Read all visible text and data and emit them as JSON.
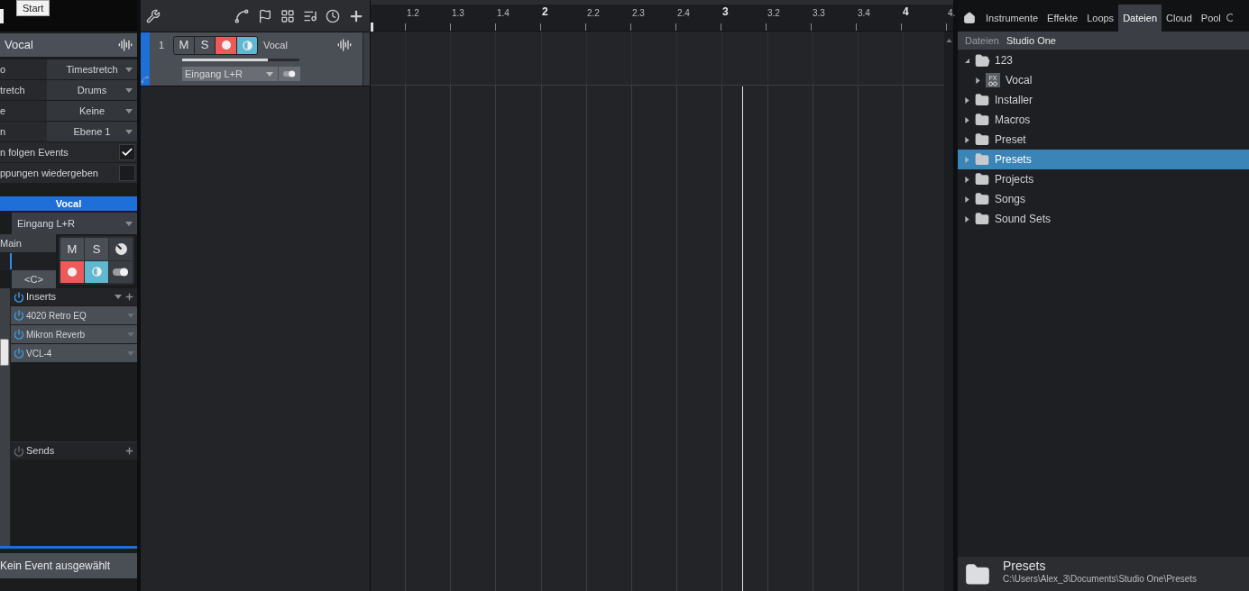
{
  "tooltip": {
    "text": "Start"
  },
  "inspector": {
    "title": "Vocal",
    "properties": [
      {
        "label": "o",
        "value": "Timestretch"
      },
      {
        "label": "tretch",
        "value": "Drums"
      },
      {
        "label": "e",
        "value": "Keine"
      },
      {
        "label": "n",
        "value": "Ebene 1"
      }
    ],
    "options": [
      {
        "label": "n folgen Events",
        "checked": true
      },
      {
        "label": "ppungen wiedergeben",
        "checked": false
      }
    ]
  },
  "channel": {
    "name": "Vocal",
    "input": "Eingang L+R",
    "output": "Main",
    "pan": "<C>",
    "mute": {
      "label": "M",
      "on": false
    },
    "solo": {
      "label": "S",
      "on": false
    },
    "record_armed": true,
    "monitor": true,
    "inserts": {
      "title": "Inserts",
      "on": true,
      "items": [
        {
          "name": "4020 Retro EQ",
          "on": true
        },
        {
          "name": "Mikron Reverb",
          "on": true
        },
        {
          "name": "VCL-4",
          "on": true
        }
      ]
    },
    "sends": {
      "title": "Sends",
      "on": false
    }
  },
  "status": "Kein Event ausgewählt",
  "track": {
    "number": "1",
    "name": "Vocal",
    "mute": {
      "label": "M",
      "on": false
    },
    "solo": {
      "label": "S",
      "on": false
    },
    "record_armed": true,
    "monitor": true,
    "level": 0.73,
    "input": "Eingang L+R",
    "selected": true
  },
  "ruler": [
    {
      "label": "1.2",
      "kind": "beat"
    },
    {
      "label": "1.3",
      "kind": "beat"
    },
    {
      "label": "1.4",
      "kind": "beat"
    },
    {
      "label": "2",
      "kind": "bar"
    },
    {
      "label": "2.2",
      "kind": "beat"
    },
    {
      "label": "2.3",
      "kind": "beat"
    },
    {
      "label": "2.4",
      "kind": "beat"
    },
    {
      "label": "3",
      "kind": "bar"
    },
    {
      "label": "3.2",
      "kind": "beat"
    },
    {
      "label": "3.3",
      "kind": "beat"
    },
    {
      "label": "3.4",
      "kind": "beat"
    },
    {
      "label": "4",
      "kind": "bar"
    },
    {
      "label": "4.",
      "kind": "beat"
    }
  ],
  "browser": {
    "tabs": [
      {
        "label": "Instrumente",
        "selected": false
      },
      {
        "label": "Effekte",
        "selected": false
      },
      {
        "label": "Loops",
        "selected": false
      },
      {
        "label": "Dateien",
        "selected": true
      },
      {
        "label": "Cloud",
        "selected": false
      },
      {
        "label": "Pool",
        "selected": false
      }
    ],
    "breadcrumb": [
      {
        "label": "Dateien",
        "selected": false
      },
      {
        "label": "Studio One",
        "selected": true
      }
    ],
    "tree": [
      {
        "name": "123",
        "kind": "folder",
        "expanded": true,
        "selected": false,
        "children": [
          {
            "name": "Vocal",
            "kind": "fx",
            "icon_text": "FX",
            "expanded": false,
            "selected": false
          }
        ]
      },
      {
        "name": "Installer",
        "kind": "folder",
        "expanded": false,
        "selected": false
      },
      {
        "name": "Macros",
        "kind": "folder",
        "expanded": false,
        "selected": false
      },
      {
        "name": "Preset",
        "kind": "folder",
        "expanded": false,
        "selected": false
      },
      {
        "name": "Presets",
        "kind": "folder",
        "expanded": false,
        "selected": true
      },
      {
        "name": "Projects",
        "kind": "folder",
        "expanded": false,
        "selected": false
      },
      {
        "name": "Songs",
        "kind": "folder",
        "expanded": false,
        "selected": false
      },
      {
        "name": "Sound Sets",
        "kind": "folder",
        "expanded": false,
        "selected": false
      }
    ],
    "footer": {
      "title": "Presets",
      "path": "C:\\Users\\Alex_3\\Documents\\Studio One\\Presets"
    }
  }
}
